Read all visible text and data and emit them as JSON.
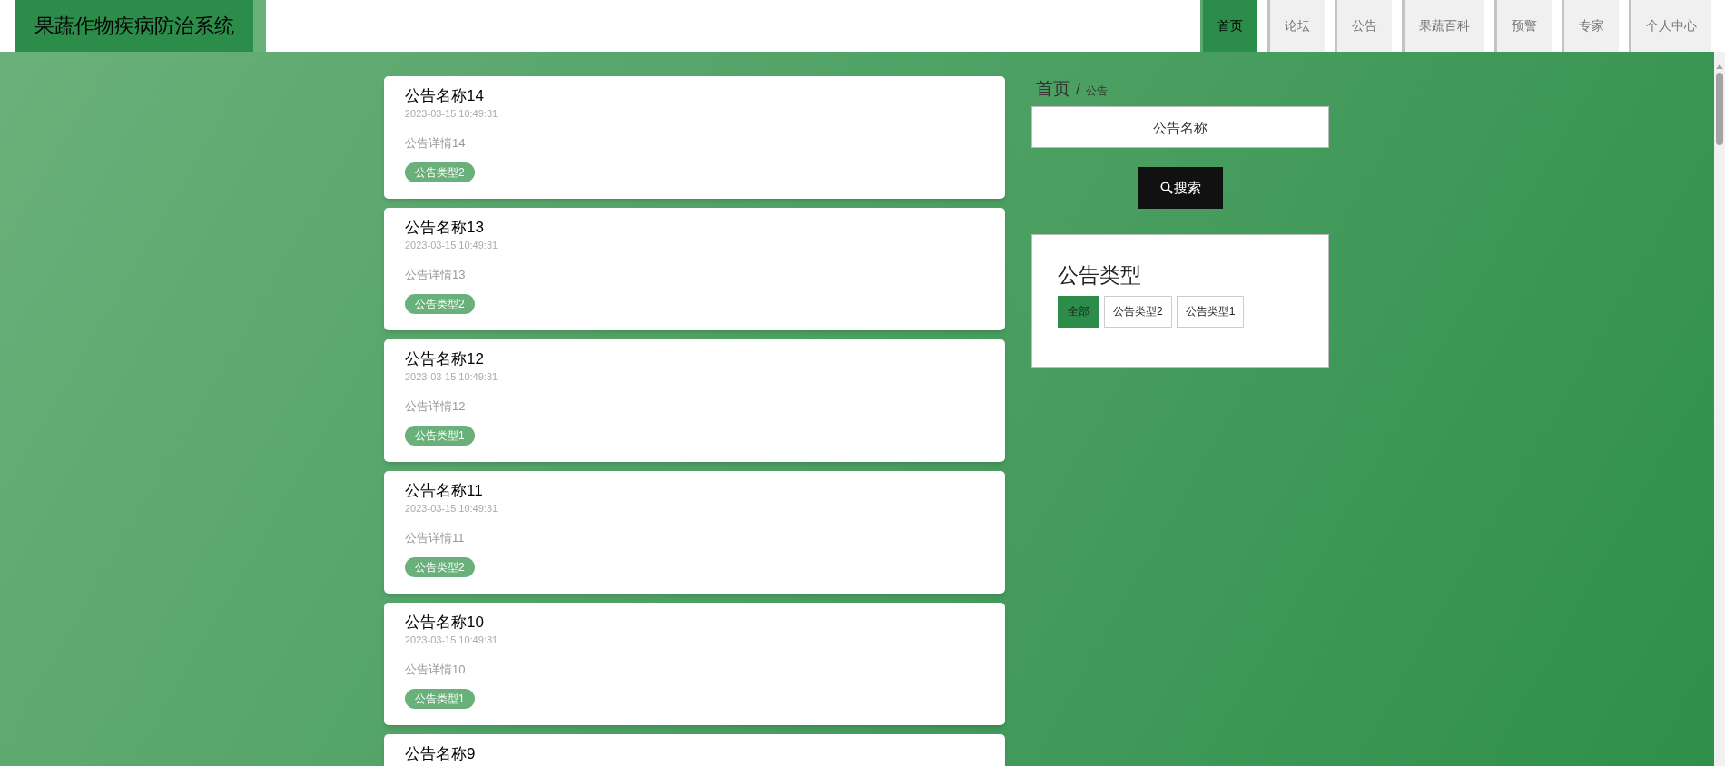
{
  "header": {
    "title": "果蔬作物疾病防治系统"
  },
  "nav": [
    {
      "label": "首页",
      "selected": true
    },
    {
      "label": "论坛",
      "selected": false
    },
    {
      "label": "公告",
      "selected": false
    },
    {
      "label": "果蔬百科",
      "selected": false
    },
    {
      "label": "预警",
      "selected": false
    },
    {
      "label": "专家",
      "selected": false
    },
    {
      "label": "个人中心",
      "selected": false
    }
  ],
  "notices": [
    {
      "name": "公告名称14",
      "time": "2023-03-15 10:49:31",
      "detail": "公告详情14",
      "type": "公告类型2"
    },
    {
      "name": "公告名称13",
      "time": "2023-03-15 10:49:31",
      "detail": "公告详情13",
      "type": "公告类型2"
    },
    {
      "name": "公告名称12",
      "time": "2023-03-15 10:49:31",
      "detail": "公告详情12",
      "type": "公告类型1"
    },
    {
      "name": "公告名称11",
      "time": "2023-03-15 10:49:31",
      "detail": "公告详情11",
      "type": "公告类型2"
    },
    {
      "name": "公告名称10",
      "time": "2023-03-15 10:49:31",
      "detail": "公告详情10",
      "type": "公告类型1"
    },
    {
      "name": "公告名称9"
    }
  ],
  "breadcrumb": {
    "home": "首页",
    "separator": "/",
    "current": "公告"
  },
  "search": {
    "placeholder": "公告名称",
    "button": "搜索"
  },
  "type_filter": {
    "title": "公告类型",
    "options": [
      {
        "label": "全部",
        "selected": true
      },
      {
        "label": "公告类型2",
        "selected": false
      },
      {
        "label": "公告类型1",
        "selected": false
      }
    ]
  }
}
